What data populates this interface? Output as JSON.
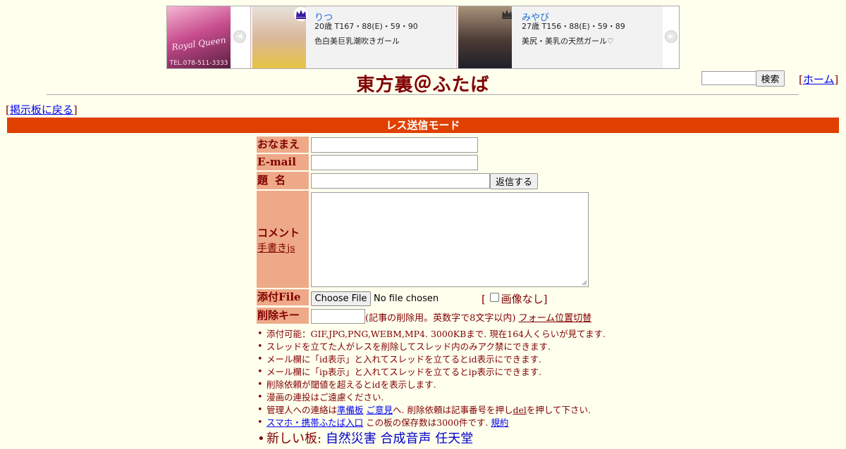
{
  "banner": {
    "logo_text": "Royal Queen",
    "logo_tel": "TEL.078-511-3333",
    "cards": [
      {
        "name": "りつ",
        "spec": "20歳 T167・88(E)・59・90",
        "catch": "色白美巨乳潮吹きガール"
      },
      {
        "name": "みやび",
        "spec": "27歳 T156・88(E)・59・89",
        "catch": "美尻・美乳の天然ガール♡"
      }
    ]
  },
  "header": {
    "title": "東方裏＠ふたば",
    "search_button": "検索",
    "home_open": "[",
    "home_label": "ホーム",
    "home_close": "]"
  },
  "nav": {
    "back_open": "[",
    "back_label": "掲示板に戻る",
    "back_close": "]"
  },
  "mode_bar": "レス送信モード",
  "form": {
    "name_label": "おなまえ",
    "email_label": "E-mail",
    "subject_label": "題名",
    "reply_button": "返信する",
    "comment_label": "コメント",
    "handwriting_link": "手書きjs",
    "file_label": "添付File",
    "choose_file_button": "Choose File",
    "file_status": "No file chosen",
    "no_image_open": "[",
    "no_image_label": "画像なし",
    "no_image_close": "]",
    "delkey_label": "削除キー",
    "delkey_note": "(記事の削除用。英数字で8文字以内)",
    "form_toggle_link": "フォーム位置切替"
  },
  "notes": {
    "n1": "添付可能：GIF,JPG,PNG,WEBM,MP4. 3000KBまで. 現在164人くらいが見てます.",
    "n2": "スレッドを立てた人がレスを削除してスレッド内のみアク禁にできます.",
    "n3": "メール欄に「id表示」と入れてスレッドを立てるとid表示にできます.",
    "n4": "メール欄に「ip表示」と入れてスレッドを立てるとip表示にできます.",
    "n5": "削除依頼が閾値を超えるとidを表示します.",
    "n6": "漫画の連投はご遠慮ください.",
    "n7_a": "管理人への連絡は",
    "n7_link1": "準備板",
    "n7_link2": "ご意見",
    "n7_b": "へ. 削除依頼は記事番号を押し",
    "n7_link3": "del",
    "n7_c": "を押して下さい.",
    "n8_link1": "スマホ・携帯ふたば入口",
    "n8_a": "この板の保存数は3000件です.",
    "n8_link2": "規約",
    "n9_a": "新しい板:",
    "n9_link1": "自然災害",
    "n9_link2": "合成音声",
    "n9_link3": "任天堂"
  },
  "colors": {
    "background": "#ffffee",
    "text": "#800000",
    "mode_bar": "#e04000",
    "label_cell": "#eeaa88",
    "link": "#0000ee"
  }
}
